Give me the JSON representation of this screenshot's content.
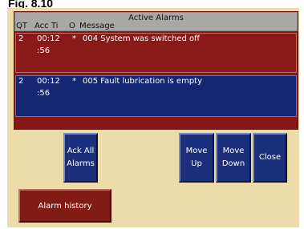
{
  "figure_label": "Fig. 8.10",
  "alarm_panel": {
    "title": "Active Alarms",
    "columns": [
      "QT",
      "Acc Ti",
      "O",
      "Message"
    ],
    "rows": [
      {
        "qt": "2",
        "time_line1": "00:12",
        "time_line2": ":56",
        "o": "*",
        "message": "004 System was switched off"
      },
      {
        "qt": "2",
        "time_line1": "00:12",
        "time_line2": ":56",
        "o": "*",
        "message": "005 Fault lubrication is empty"
      }
    ]
  },
  "buttons": {
    "ack_all_line1": "Ack All",
    "ack_all_line2": "Alarms",
    "move_up_line1": "Move",
    "move_up_line2": "Up",
    "move_down_line1": "Move",
    "move_down_line2": "Down",
    "close": "Close",
    "alarm_history": "Alarm history"
  },
  "colors": {
    "panel_background": "#ecdcaa",
    "frame_red": "#861716",
    "selected_row_blue": "#152673",
    "header_gray": "#a8a8a6",
    "button_blue": "#1c2f7c",
    "button_red": "#811c14"
  }
}
